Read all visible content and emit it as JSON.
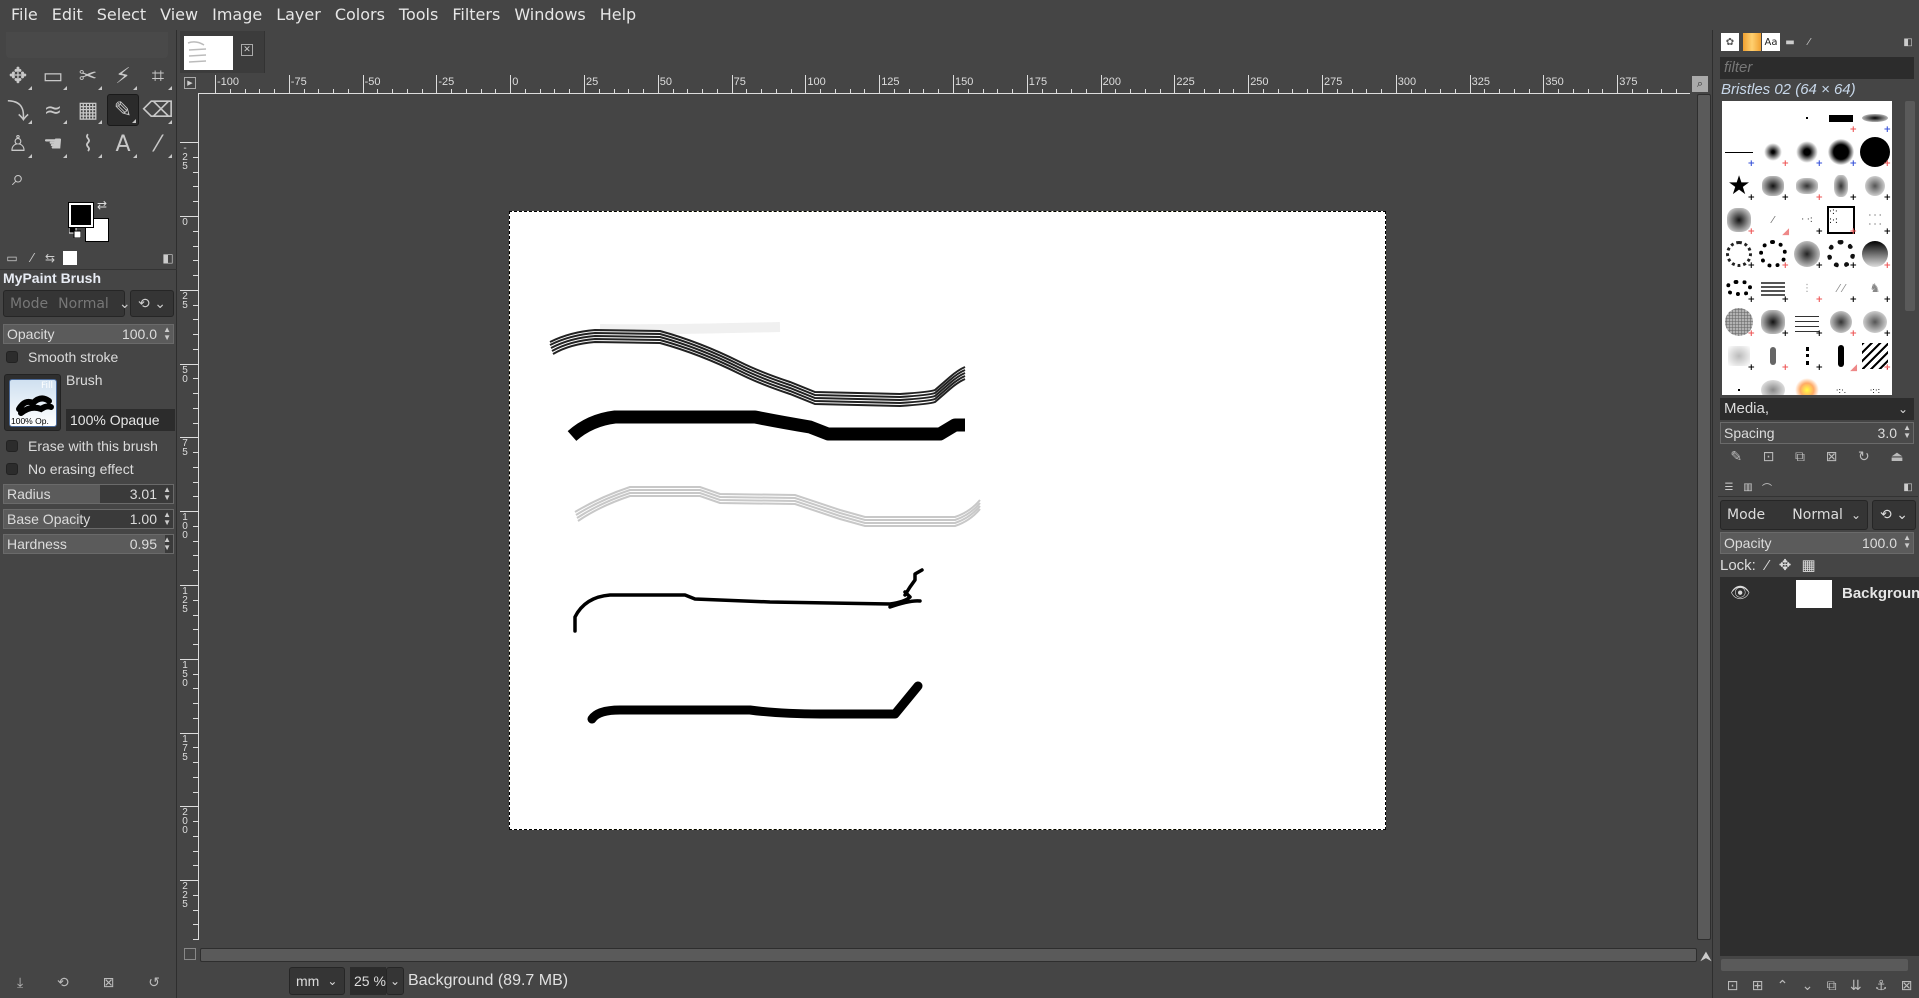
{
  "menubar": {
    "items": [
      "File",
      "Edit",
      "Select",
      "View",
      "Image",
      "Layer",
      "Colors",
      "Tools",
      "Filters",
      "Windows",
      "Help"
    ]
  },
  "toolbox": {
    "tools": [
      {
        "name": "move-tool",
        "glyph": "✥"
      },
      {
        "name": "rect-select-tool",
        "glyph": "▭"
      },
      {
        "name": "scissors-select-tool",
        "glyph": "✂"
      },
      {
        "name": "fuzzy-select-tool",
        "glyph": "⚡"
      },
      {
        "name": "crop-tool",
        "glyph": "⌗"
      },
      {
        "name": "unified-transform-tool",
        "glyph": "⤵"
      },
      {
        "name": "warp-transform-tool",
        "glyph": "≈"
      },
      {
        "name": "gradient-tool",
        "glyph": "▦"
      },
      {
        "name": "mypaint-brush-tool",
        "glyph": "✎",
        "active": true
      },
      {
        "name": "eraser-tool",
        "glyph": "⌫"
      },
      {
        "name": "clone-tool",
        "glyph": "♙"
      },
      {
        "name": "smudge-tool",
        "glyph": "☚"
      },
      {
        "name": "paths-tool",
        "glyph": "⌇"
      },
      {
        "name": "text-tool",
        "glyph": "A"
      },
      {
        "name": "color-picker-tool",
        "glyph": "⁄"
      },
      {
        "name": "zoom-tool",
        "glyph": "⌕"
      }
    ],
    "fg_color": "#000000",
    "bg_color": "#ffffff"
  },
  "tool_options": {
    "title": "MyPaint Brush",
    "mode_label": "Mode",
    "mode_value": "Normal",
    "opacity_label": "Opacity",
    "opacity_value": "100.0",
    "smooth_stroke": "Smooth stroke",
    "brush_label": "Brush",
    "brush_name": "100% Opaque",
    "brush_preview_top": "Fill",
    "brush_preview_bottom": "100% Op.",
    "erase": "Erase with this brush",
    "no_erasing": "No erasing effect",
    "radius_label": "Radius",
    "radius_value": "3.01",
    "radius_fraction": 0.57,
    "base_opacity_label": "Base Opacity",
    "base_opacity_value": "1.00",
    "base_opacity_fraction": 0.45,
    "hardness_label": "Hardness",
    "hardness_value": "0.95",
    "hardness_fraction": 0.95
  },
  "image_tab": {
    "close": "✕"
  },
  "rulers": {
    "horizontal": [
      "-100",
      "-75",
      "-50",
      "-25",
      "0",
      "25",
      "50",
      "75",
      "100",
      "125",
      "150",
      "175",
      "200",
      "225",
      "250",
      "275",
      "300",
      "325",
      "350",
      "375"
    ],
    "vertical": [
      "-25",
      "0",
      "25",
      "50",
      "75",
      "100",
      "125",
      "150",
      "175",
      "200",
      "225"
    ]
  },
  "statusbar": {
    "unit": "mm",
    "zoom": "25 %",
    "info": "Background (89.7 MB)"
  },
  "brushes_panel": {
    "filter_placeholder": "filter",
    "selected_brush": "Bristles 02 (64 × 64)",
    "tag_filter": "Media,",
    "spacing_label": "Spacing",
    "spacing_value": "3.0"
  },
  "layers_panel": {
    "mode_label": "Mode",
    "mode_value": "Normal",
    "opacity_label": "Opacity",
    "opacity_value": "100.0",
    "lock_label": "Lock:",
    "layers": [
      {
        "name": "Background",
        "visible": true
      }
    ]
  }
}
